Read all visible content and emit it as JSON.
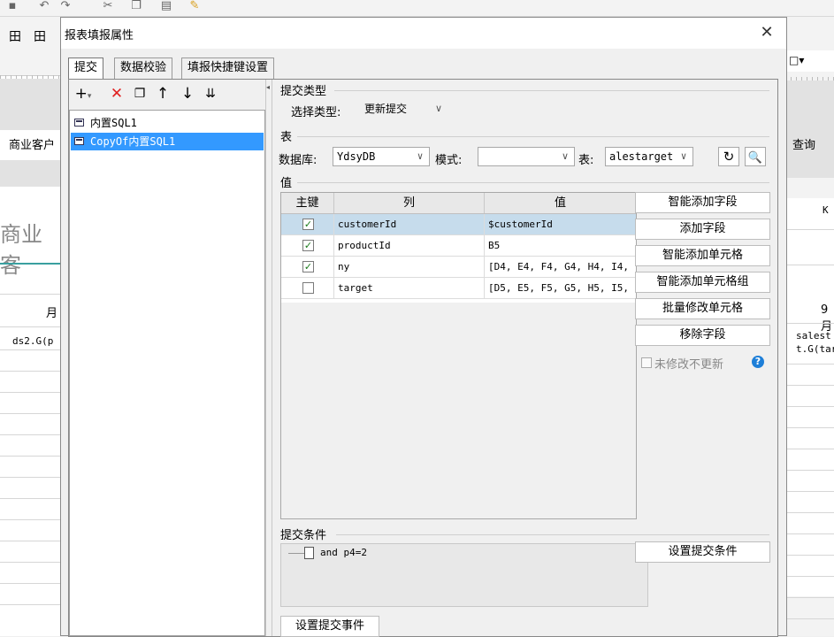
{
  "app": {
    "row2_icons": [
      "grid-icon",
      "grid-alt-icon"
    ],
    "bg_left_header": "商业客户",
    "bg_left_big": "商业客",
    "bg_left_month": "月",
    "bg_left_cell": "ds2.G(p",
    "bg_right_query": "查询",
    "bg_right_col": "K",
    "bg_right_month": "9月",
    "bg_right_cell1": "salest",
    "bg_right_cell2": "t.G(tar"
  },
  "dialog": {
    "title": "报表填报属性",
    "tabs": [
      {
        "label": "提交",
        "active": true
      },
      {
        "label": "数据校验",
        "active": false
      },
      {
        "label": "填报快捷键设置",
        "active": false
      }
    ],
    "tree_items": [
      {
        "label": "内置SQL1",
        "selected": false
      },
      {
        "label": "CopyOf内置SQL1",
        "selected": true
      }
    ],
    "submit_type": {
      "section": "提交类型",
      "label": "选择类型:",
      "value": "更新提交"
    },
    "table_section": {
      "section": "表",
      "db_label": "数据库:",
      "db_value": "YdsyDB",
      "mode_label": "模式:",
      "mode_value": "",
      "table_label": "表:",
      "table_value": "alestarget"
    },
    "values_section": {
      "section": "值",
      "columns": [
        "主键",
        "列",
        "值"
      ],
      "rows": [
        {
          "key": true,
          "column": "customerId",
          "value": "$customerId",
          "selected": true
        },
        {
          "key": true,
          "column": "productId",
          "value": "B5",
          "selected": false
        },
        {
          "key": true,
          "column": "ny",
          "value": "[D4, E4, F4, G4, H4, I4, ...",
          "selected": false
        },
        {
          "key": false,
          "column": "target",
          "value": "[D5, E5, F5, G5, H5, I5, ...",
          "selected": false
        }
      ],
      "buttons": [
        "智能添加字段",
        "添加字段",
        "智能添加单元格",
        "智能添加单元格组",
        "批量修改单元格",
        "移除字段"
      ],
      "no_update_label": "未修改不更新",
      "no_update_checked": false
    },
    "condition_section": {
      "section": "提交条件",
      "condition": "and p4=2",
      "set_button": "设置提交条件"
    },
    "event_button": "设置提交事件"
  }
}
